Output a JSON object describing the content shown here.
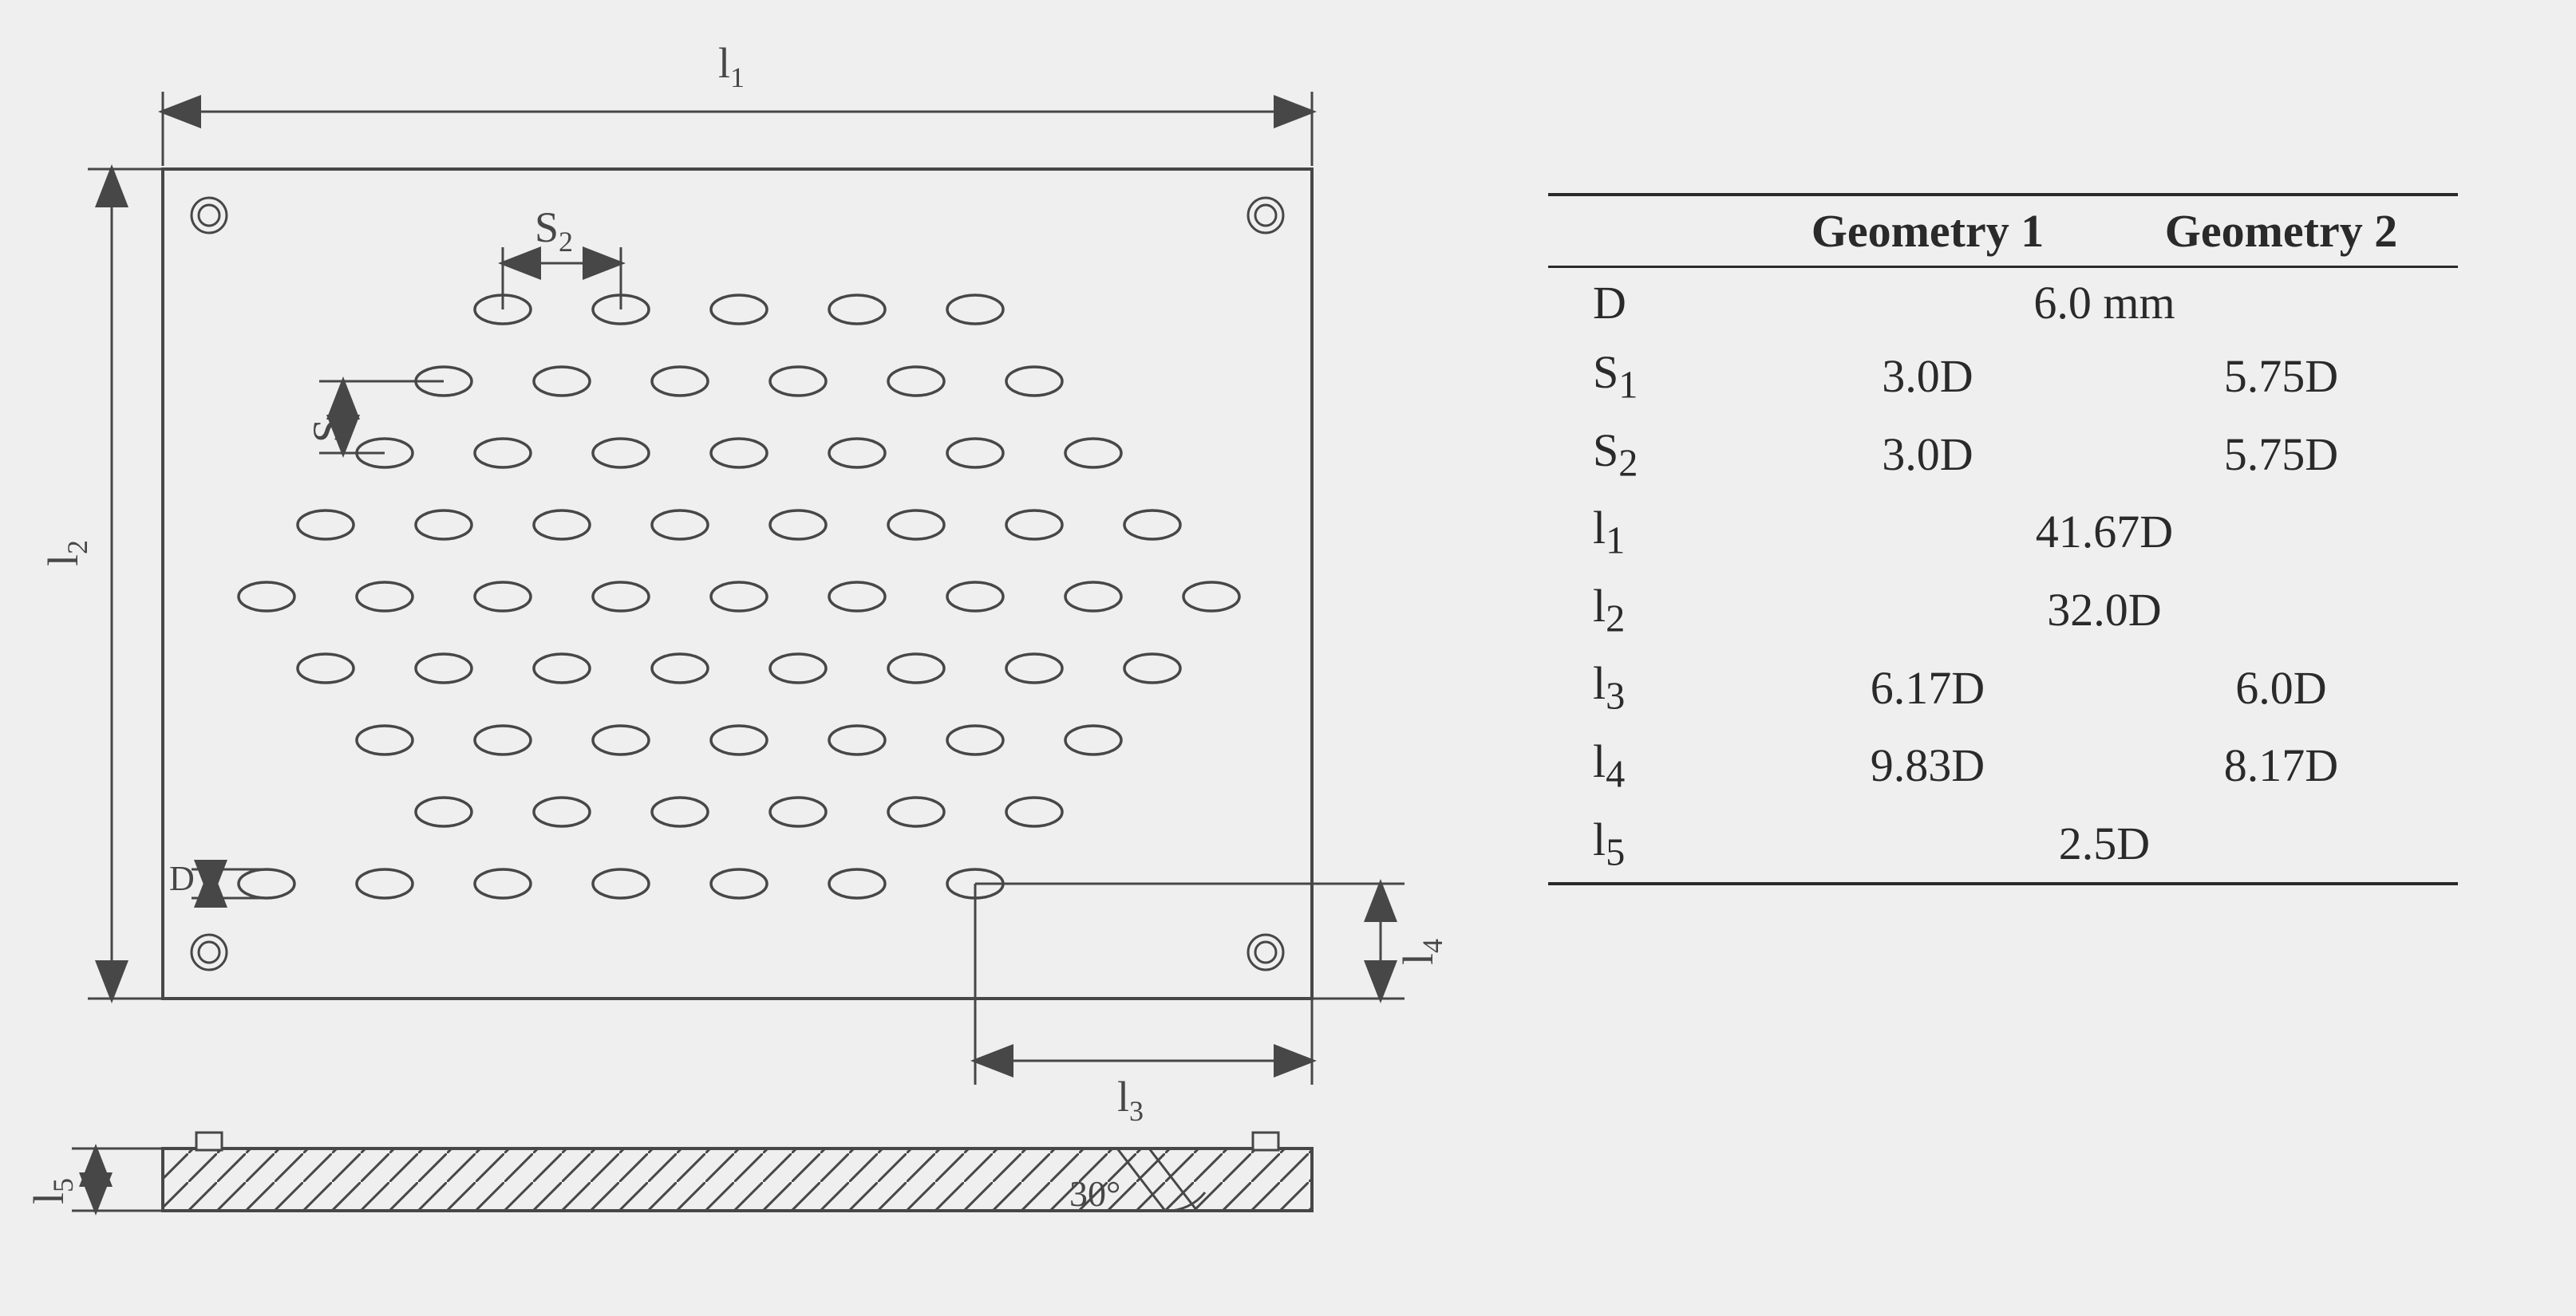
{
  "chart_data": {
    "type": "table",
    "title": "",
    "columns": [
      "",
      "Geometry 1",
      "Geometry 2"
    ],
    "rows": [
      {
        "param": "D",
        "g1": "6.0 mm",
        "g2": "6.0 mm",
        "span": true
      },
      {
        "param": "S1",
        "g1": "3.0D",
        "g2": "5.75D"
      },
      {
        "param": "S2",
        "g1": "3.0D",
        "g2": "5.75D"
      },
      {
        "param": "l1",
        "g1": "41.67D",
        "g2": "41.67D",
        "span": true
      },
      {
        "param": "l2",
        "g1": "32.0D",
        "g2": "32.0D",
        "span": true
      },
      {
        "param": "l3",
        "g1": "6.17D",
        "g2": "6.0D"
      },
      {
        "param": "l4",
        "g1": "9.83D",
        "g2": "8.17D"
      },
      {
        "param": "l5",
        "g1": "2.5D",
        "g2": "2.5D",
        "span": true
      }
    ]
  },
  "table": {
    "head": {
      "blank": "",
      "g1": "Geometry 1",
      "g2": "Geometry 2"
    },
    "rows": {
      "D": {
        "p": "D",
        "v": "6.0 mm"
      },
      "S1": {
        "p": "S",
        "s": "1",
        "g1": "3.0D",
        "g2": "5.75D"
      },
      "S2": {
        "p": "S",
        "s": "2",
        "g1": "3.0D",
        "g2": "5.75D"
      },
      "l1": {
        "p": "l",
        "s": "1",
        "v": "41.67D"
      },
      "l2": {
        "p": "l",
        "s": "2",
        "v": "32.0D"
      },
      "l3": {
        "p": "l",
        "s": "3",
        "g1": "6.17D",
        "g2": "6.0D"
      },
      "l4": {
        "p": "l",
        "s": "4",
        "g1": "9.83D",
        "g2": "8.17D"
      },
      "l5": {
        "p": "l",
        "s": "5",
        "v": "2.5D"
      }
    }
  },
  "labels": {
    "l1": "l",
    "l1s": "1",
    "l2": "l",
    "l2s": "2",
    "l3": "l",
    "l3s": "3",
    "l4": "l",
    "l4s": "4",
    "l5": "l",
    "l5s": "5",
    "s1": "S",
    "s1s": "1",
    "s2": "S",
    "s2s": "2",
    "D": "D",
    "angle": "30°"
  }
}
